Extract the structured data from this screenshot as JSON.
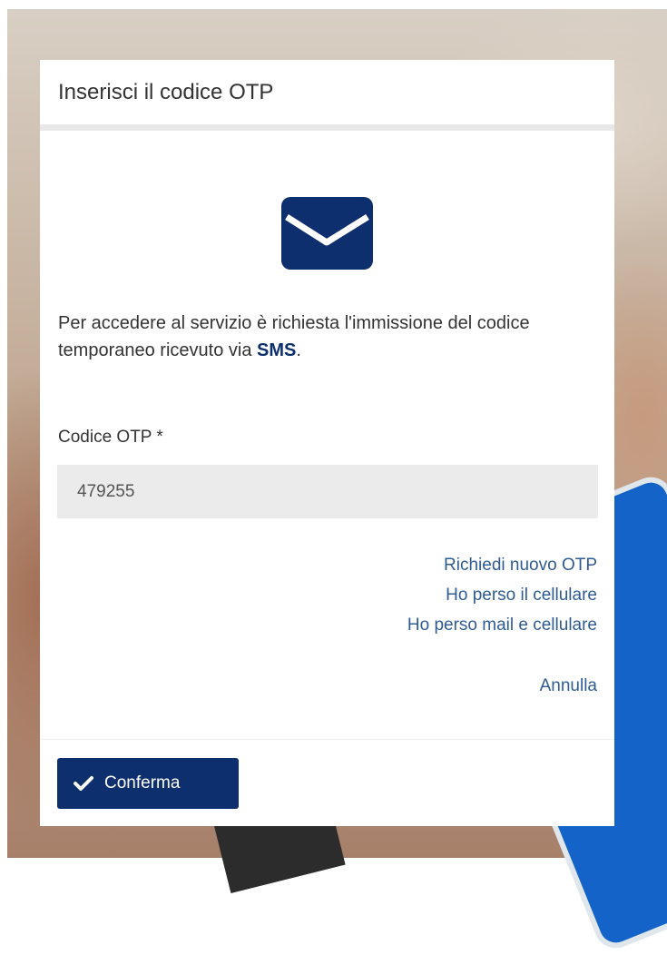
{
  "dialog": {
    "title": "Inserisci il codice OTP",
    "icon": "envelope-icon",
    "description_prefix": "Per accedere al servizio è richiesta l'immissione del codice temporaneo ricevuto via ",
    "description_emphasis": "SMS",
    "description_suffix": "."
  },
  "otp_field": {
    "label": "Codice OTP *",
    "value": "479255"
  },
  "links": {
    "request_new": "Richiedi nuovo OTP",
    "lost_phone": "Ho perso il cellulare",
    "lost_mail_phone": "Ho perso mail e cellulare",
    "cancel": "Annulla"
  },
  "actions": {
    "confirm_label": "Conferma",
    "confirm_icon": "check-icon"
  },
  "colors": {
    "primary": "#0d2f6e",
    "link": "#2f5c93",
    "input_bg": "#ebebeb"
  }
}
